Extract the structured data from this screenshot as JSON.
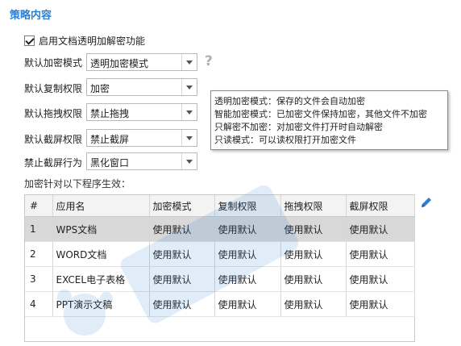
{
  "section": {
    "title": "策略内容"
  },
  "enable": {
    "label": "启用文档透明加解密功能",
    "checked": true
  },
  "settings": [
    {
      "label": "默认加密模式",
      "value": "透明加密模式"
    },
    {
      "label": "默认复制权限",
      "value": "加密"
    },
    {
      "label": "默认拖拽权限",
      "value": "禁止拖拽"
    },
    {
      "label": "默认截屏权限",
      "value": "禁止截屏"
    },
    {
      "label": "禁止截屏行为",
      "value": "黑化窗口"
    }
  ],
  "help": {
    "icon": "question-icon",
    "glyph": "?"
  },
  "tooltip": {
    "lines": [
      "透明加密模式：保存的文件会自动加密",
      "智能加密模式：已加密文件保持加密，其他文件不加密",
      "只解密不加密：对加密文件打开时自动解密",
      "只读模式：可以读权限打开加密文件"
    ]
  },
  "apply": {
    "caption": "加密针对以下程序生效：",
    "edit_icon": "pencil-icon"
  },
  "table": {
    "headers": [
      "#",
      "应用名",
      "加密模式",
      "复制权限",
      "拖拽权限",
      "截屏权限"
    ],
    "rows": [
      [
        "1",
        "WPS文档",
        "使用默认",
        "使用默认",
        "使用默认",
        "使用默认"
      ],
      [
        "2",
        "WORD文档",
        "使用默认",
        "使用默认",
        "使用默认",
        "使用默认"
      ],
      [
        "3",
        "EXCEL电子表格",
        "使用默认",
        "使用默认",
        "使用默认",
        "使用默认"
      ],
      [
        "4",
        "PPT演示文稿",
        "使用默认",
        "使用默认",
        "使用默认",
        "使用默认"
      ]
    ],
    "selected_row": 0
  },
  "colors": {
    "accent": "#2a7fd4",
    "selected_row": "#d8d8d8"
  }
}
